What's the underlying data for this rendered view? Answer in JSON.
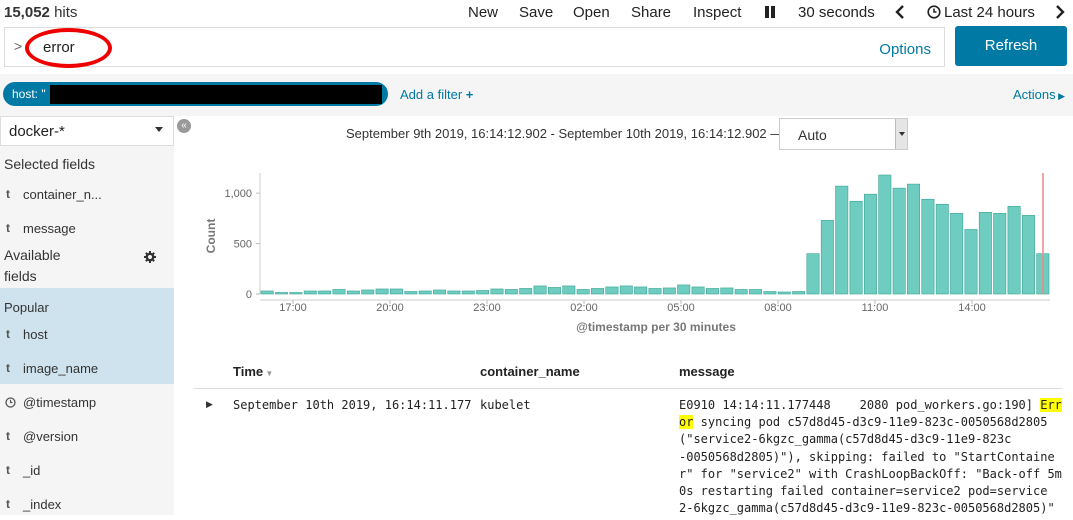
{
  "header": {
    "hits_count": "15,052",
    "hits_label": "hits",
    "menu": [
      "New",
      "Save",
      "Open",
      "Share",
      "Inspect"
    ],
    "refresh_interval": "30 seconds",
    "time_range": "Last 24 hours"
  },
  "search": {
    "query": "error",
    "options_label": "Options",
    "refresh_label": "Refresh"
  },
  "filters": {
    "pill_label": "host: \"",
    "add_filter_label": "Add a filter",
    "actions_label": "Actions"
  },
  "sidebar": {
    "index_pattern": "docker-*",
    "selected_title": "Selected fields",
    "selected_fields": [
      {
        "type": "t",
        "name": "container_n..."
      },
      {
        "type": "t",
        "name": "message"
      }
    ],
    "available_title_1": "Available",
    "available_title_2": "fields",
    "popular_title": "Popular",
    "popular_fields": [
      {
        "type": "t",
        "name": "host"
      },
      {
        "type": "t",
        "name": "image_name"
      }
    ],
    "other_fields": [
      {
        "type": "clock",
        "name": "@timestamp"
      },
      {
        "type": "t",
        "name": "@version"
      },
      {
        "type": "t",
        "name": "_id"
      },
      {
        "type": "t",
        "name": "_index"
      }
    ]
  },
  "histogram": {
    "date_range": "September 9th 2019, 16:14:12.902 - September 10th 2019, 16:14:12.902 —",
    "interval": "Auto"
  },
  "chart_data": {
    "type": "bar",
    "title": "",
    "ylabel": "Count",
    "xlabel": "@timestamp per 30 minutes",
    "ylim": [
      0,
      1200
    ],
    "yticks": [
      "0",
      "500",
      "1,000"
    ],
    "xticks": [
      "17:00",
      "20:00",
      "23:00",
      "02:00",
      "05:00",
      "08:00",
      "11:00",
      "14:00"
    ],
    "color": "#6eccc0",
    "values": [
      30,
      15,
      15,
      30,
      30,
      45,
      30,
      40,
      50,
      50,
      25,
      30,
      40,
      30,
      30,
      35,
      50,
      45,
      55,
      80,
      65,
      80,
      45,
      55,
      70,
      80,
      70,
      55,
      60,
      90,
      70,
      55,
      60,
      45,
      45,
      25,
      20,
      25,
      400,
      730,
      1070,
      920,
      990,
      1180,
      1050,
      1090,
      940,
      890,
      800,
      640,
      810,
      800,
      870,
      780,
      400
    ]
  },
  "table": {
    "headers": [
      "Time",
      "container_name",
      "message"
    ],
    "row": {
      "time": "September 10th 2019, 16:14:11.177",
      "container_name": "kubelet",
      "message_lines": [
        [
          "E0910 14:14:11.177448    2080 pod_workers.go:190] ",
          "Err"
        ],
        [
          "",
          "or",
          " syncing pod c57d8d45-d3c9-11e9-823c-0050568d2805"
        ],
        [
          "(\"service2-6kgzc_gamma(c57d8d45-d3c9-11e9-823c"
        ],
        [
          "-0050568d2805)\"), skipping: failed to \"StartContaine"
        ],
        [
          "r\" for \"service2\" with CrashLoopBackOff: \"Back-off 5m"
        ],
        [
          "0s restarting failed container=service2 pod=service"
        ],
        [
          "2-6kgzc_gamma(c57d8d45-d3c9-11e9-823c-0050568d2805)\""
        ]
      ]
    }
  }
}
